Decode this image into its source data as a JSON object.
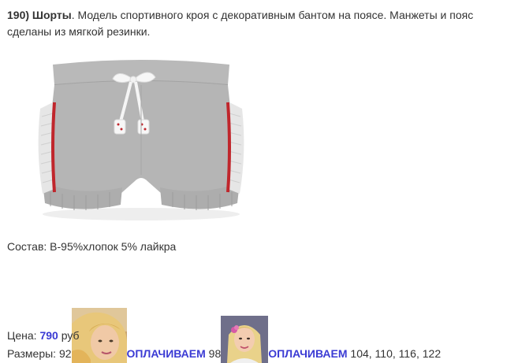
{
  "product": {
    "number_title": "190) Шорты",
    "description": ". Модель спортивного кроя с декоративным бантом на поясе. Манжеты и пояс сделаны из мягкой резинки."
  },
  "composition": "Состав: В-95%хлопок 5% лайкра",
  "sizes": {
    "label": "Размеры: 92",
    "pay_label_1": "ОПЛАЧИВАЕМ",
    "size_2": " 98",
    "pay_label_2": "ОПЛАЧИВАЕМ",
    "rest": " 104, 110, 116, 122"
  },
  "price": {
    "label": "Цена: ",
    "amount": "790",
    "currency": " руб"
  },
  "colors": {
    "link": "#3b3bd4",
    "text": "#333333",
    "shorts_gray": "#b4b4b4",
    "stripe_red": "#c0262c"
  },
  "icons": {
    "product_image": "gray-shorts-image",
    "avatar_1": "user-avatar-blonde",
    "avatar_2": "user-avatar-blonde-flower"
  }
}
